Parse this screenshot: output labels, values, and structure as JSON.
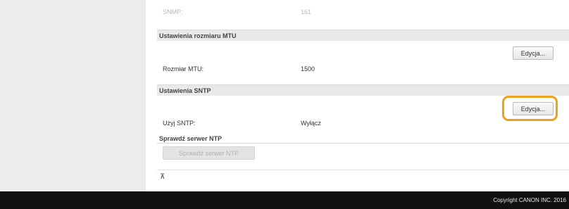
{
  "snmp": {
    "label": "SNMP:",
    "value": "161"
  },
  "mtu_section": {
    "title": "Ustawienia rozmiaru MTU",
    "edit_label": "Edycja...",
    "field_label": "Rozmiar MTU:",
    "field_value": "1500"
  },
  "sntp_section": {
    "title": "Ustawienia SNTP",
    "edit_label": "Edycja...",
    "field_label": "Użyj SNTP:",
    "field_value": "Wyłącz",
    "highlight_color": "#f0a01c"
  },
  "ntp_check": {
    "title": "Sprawdź serwer NTP",
    "button_label": "Sprawdź serwer NTP"
  },
  "back_to_top_glyph": "⊼",
  "footer": {
    "copyright": "Copyright CANON INC. 2016"
  }
}
